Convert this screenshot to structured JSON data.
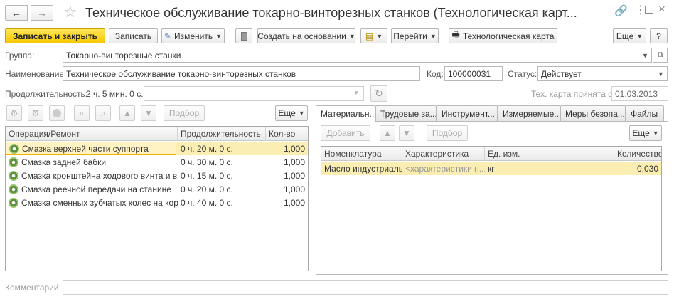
{
  "window": {
    "title": "Техническое обслуживание токарно-винторезных станков (Технологическая карт..."
  },
  "toolbar": {
    "save_close": "Записать и закрыть",
    "save": "Записать",
    "edit": "Изменить",
    "create_based": "Создать на основании",
    "goto": "Перейти",
    "tech_card": "Технологическая карта",
    "more": "Еще",
    "help": "?"
  },
  "form": {
    "group_label": "Группа:",
    "group_value": "Токарно-винторезные станки",
    "name_label": "Наименование:",
    "name_value": "Техническое обслуживание токарно-винторезных станков",
    "code_label": "Код:",
    "code_value": "100000031",
    "status_label": "Статус:",
    "status_value": "Действует",
    "duration_label": "Продолжительность:",
    "duration_value": "2 ч. 5 мин. 0 с.",
    "accepted_label": "Тех. карта принята с:",
    "accepted_value": "01.03.2013",
    "comment_label": "Комментарий:"
  },
  "ops": {
    "pick": "Подбор",
    "more": "Еще",
    "columns": [
      "Операция/Ремонт",
      "Продолжительность",
      "Кол-во"
    ],
    "rows": [
      {
        "name": "Смазка верхней части суппорта",
        "dur": "0 ч. 20 м. 0 с.",
        "qty": "1,000"
      },
      {
        "name": "Смазка задней бабки",
        "dur": "0 ч. 30 м. 0 с.",
        "qty": "1,000"
      },
      {
        "name": "Смазка кронштейна ходового винта и в...",
        "dur": "0 ч. 15 м. 0 с.",
        "qty": "1,000"
      },
      {
        "name": "Смазка реечной передачи на станине",
        "dur": "0 ч. 20 м. 0 с.",
        "qty": "1,000"
      },
      {
        "name": "Смазка сменных зубчатых колес на кор...",
        "dur": "0 ч. 40 м. 0 с.",
        "qty": "1,000"
      }
    ]
  },
  "tabs": [
    "Материальн...",
    "Трудовые за...",
    "Инструмент...",
    "Измеряемые...",
    "Меры безопа...",
    "Файлы"
  ],
  "materials": {
    "add": "Добавить",
    "pick": "Подбор",
    "more": "Еще",
    "columns": [
      "Номенклатура",
      "Характеристика",
      "Ед. изм.",
      "Количество"
    ],
    "rows": [
      {
        "item": "Масло индустриаль...",
        "char": "<характеристики н...",
        "unit": "кг",
        "qty": "0,030"
      }
    ]
  }
}
